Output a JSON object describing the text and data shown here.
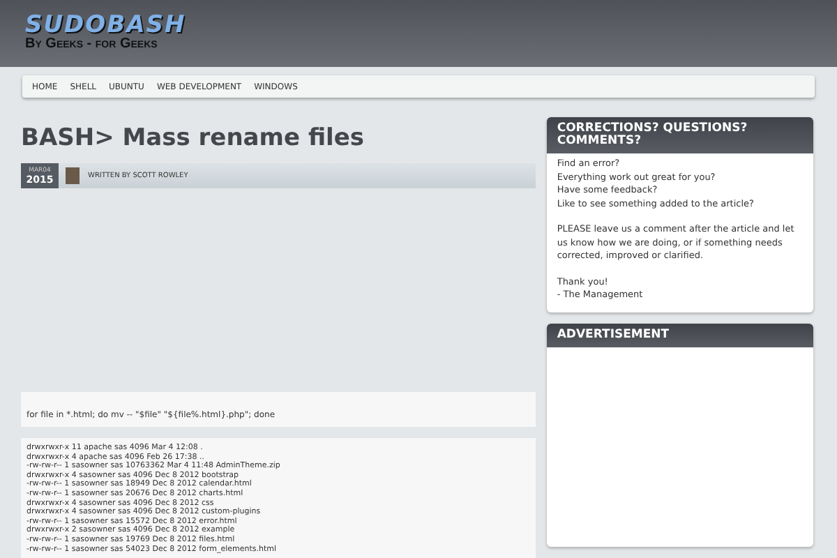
{
  "header": {
    "logo": "SUDOBASH",
    "tagline": "By Geeks - for Geeks"
  },
  "nav": [
    {
      "label": "HOME"
    },
    {
      "label": "SHELL"
    },
    {
      "label": "UBUNTU"
    },
    {
      "label": "WEB DEVELOPMENT"
    },
    {
      "label": "WINDOWS"
    }
  ],
  "article": {
    "title": "BASH> Mass rename files",
    "date_month": "MAR04",
    "date_year": "2015",
    "byline": "WRITTEN BY SCOTT ROWLEY",
    "command": "for file in *.html; do mv -- \"$file\" \"${file%.html}.php\"; done",
    "listing": [
      "drwxrwxr-x 11 apache sas 4096 Mar 4 12:08 .",
      "drwxrwxr-x 4 apache sas 4096 Feb 26 17:38 ..",
      "-rw-rw-r-- 1 sasowner sas 10763362 Mar 4 11:48 AdminTheme.zip",
      "drwxrwxr-x 4 sasowner sas 4096 Dec 8 2012 bootstrap",
      "-rw-rw-r-- 1 sasowner sas 18949 Dec 8 2012 calendar.html",
      "-rw-rw-r-- 1 sasowner sas 20676 Dec 8 2012 charts.html",
      "drwxrwxr-x 4 sasowner sas 4096 Dec 8 2012 css",
      "drwxrwxr-x 4 sasowner sas 4096 Dec 8 2012 custom-plugins",
      "-rw-rw-r-- 1 sasowner sas 15572 Dec 8 2012 error.html",
      "drwxrwxr-x 2 sasowner sas 4096 Dec 8 2012 example",
      "-rw-rw-r-- 1 sasowner sas 19769 Dec 8 2012 files.html",
      "-rw-rw-r-- 1 sasowner sas 54023 Dec 8 2012 form_elements.html"
    ]
  },
  "sidebar": [
    {
      "title": "CORRECTIONS? QUESTIONS? COMMENTS?",
      "paragraphs": [
        [
          "Find an error?",
          "Everything work out great for you?",
          "Have some feedback?",
          "Like to see something added to the article?"
        ],
        [
          "PLEASE leave us a comment after the article and let us know how we are doing, or if something needs corrected, improved or clarified."
        ],
        [
          "Thank you!",
          "- The Management"
        ]
      ]
    },
    {
      "title": "ADVERTISEMENT"
    }
  ]
}
